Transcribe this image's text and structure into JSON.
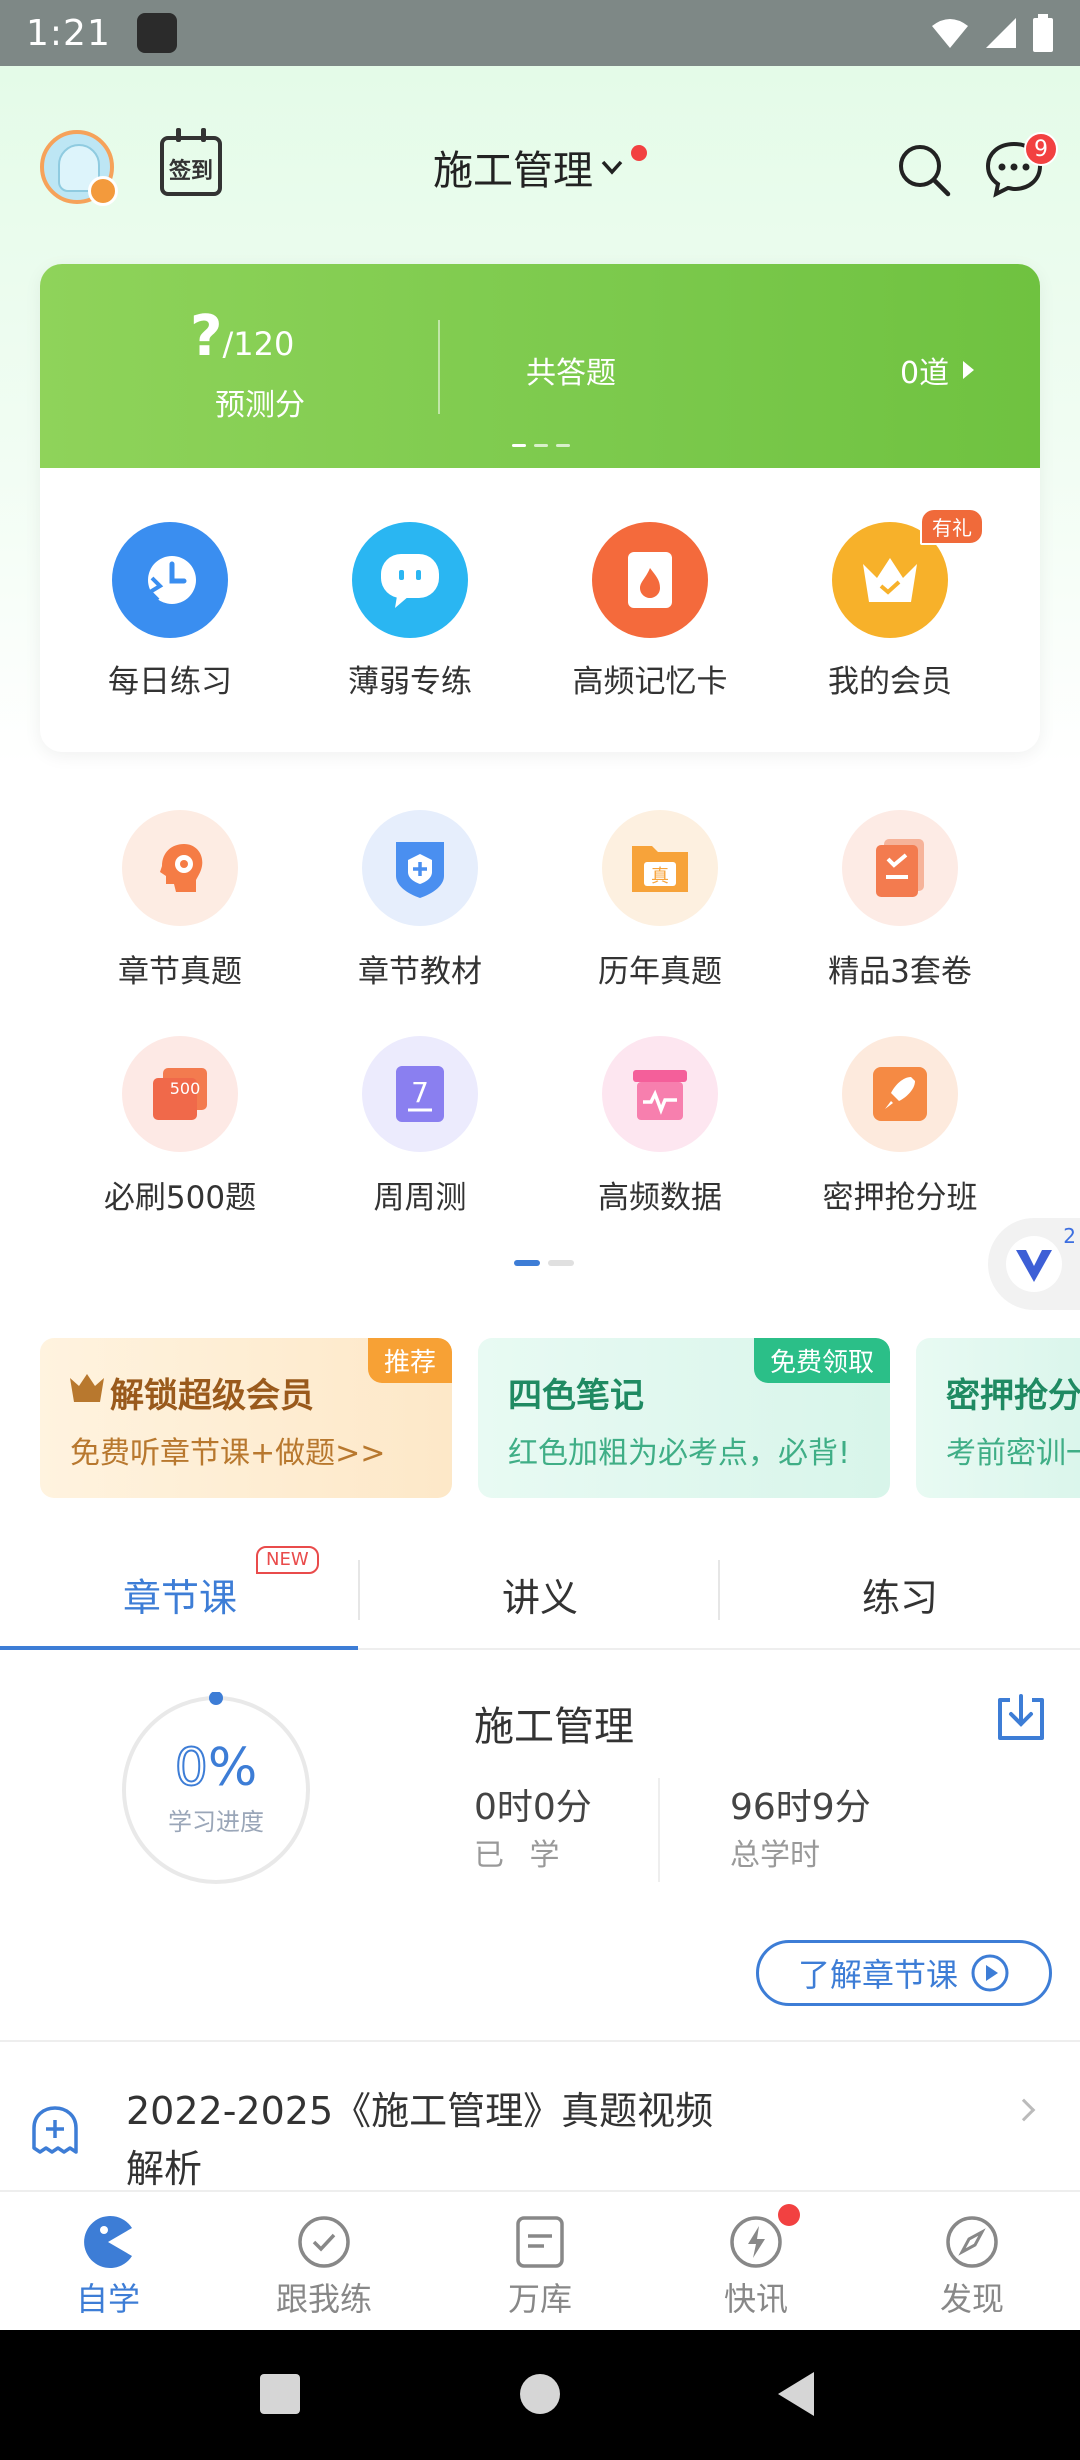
{
  "status_bar": {
    "time": "1:21"
  },
  "header": {
    "title": "施工管理",
    "checkin_label": "签到",
    "message_count": "9"
  },
  "score_card": {
    "score_value": "?",
    "score_max": "/120",
    "score_label": "预测分",
    "answered_label": "共答题",
    "answered_value": "0道"
  },
  "features": [
    {
      "label": "每日练习",
      "icon": "clock-icon",
      "color": "#3a8ef0"
    },
    {
      "label": "薄弱专练",
      "icon": "chat-bubble-icon",
      "color": "#2ab6f2"
    },
    {
      "label": "高频记忆卡",
      "icon": "flame-card-icon",
      "color": "#f46a3c"
    },
    {
      "label": "我的会员",
      "icon": "crown-icon",
      "color": "#f7b12a",
      "badge": "有礼"
    }
  ],
  "grid": [
    {
      "label": "章节真题",
      "icon": "brain-gear-icon"
    },
    {
      "label": "章节教材",
      "icon": "shield-book-icon"
    },
    {
      "label": "历年真题",
      "icon": "folder-icon",
      "glyph": "真"
    },
    {
      "label": "精品3套卷",
      "icon": "papers-icon"
    },
    {
      "label": "必刷500题",
      "icon": "card-500-icon",
      "glyph": "500"
    },
    {
      "label": "周周测",
      "icon": "calendar-7-icon",
      "glyph": "7"
    },
    {
      "label": "高频数据",
      "icon": "pulse-box-icon"
    },
    {
      "label": "密押抢分班",
      "icon": "rocket-icon"
    }
  ],
  "vip_float": {
    "count": "2"
  },
  "banners": [
    {
      "tag": "推荐",
      "title": "解锁超级会员",
      "subtitle": "免费听章节课+做题>>"
    },
    {
      "tag": "免费领取",
      "title": "四色笔记",
      "subtitle": "红色加粗为必考点，必背!"
    },
    {
      "tag": "",
      "title": "密押抢分",
      "subtitle": "考前密训一"
    }
  ],
  "tabs": [
    {
      "label": "章节课",
      "badge": "NEW",
      "active": true
    },
    {
      "label": "讲义"
    },
    {
      "label": "练习"
    }
  ],
  "course": {
    "progress_value": "0",
    "progress_unit": "%",
    "progress_fraction": 0,
    "progress_label": "学习进度",
    "title": "施工管理",
    "studied_value": "0时0分",
    "studied_label": "已 学",
    "total_value": "96时9分",
    "total_label": "总学时",
    "learn_button": "了解章节课"
  },
  "video_item": {
    "title": "2022-2025《施工管理》真题视频解析"
  },
  "bottom_nav": [
    {
      "label": "自学",
      "icon": "pacman-icon",
      "active": true
    },
    {
      "label": "跟我练",
      "icon": "check-circle-icon"
    },
    {
      "label": "万库",
      "icon": "document-icon"
    },
    {
      "label": "快讯",
      "icon": "bolt-icon",
      "dot": true
    },
    {
      "label": "发现",
      "icon": "compass-icon"
    }
  ],
  "colors": {
    "accent": "#3d7dd6",
    "green": "#7bc94c",
    "alert": "#f24141"
  }
}
